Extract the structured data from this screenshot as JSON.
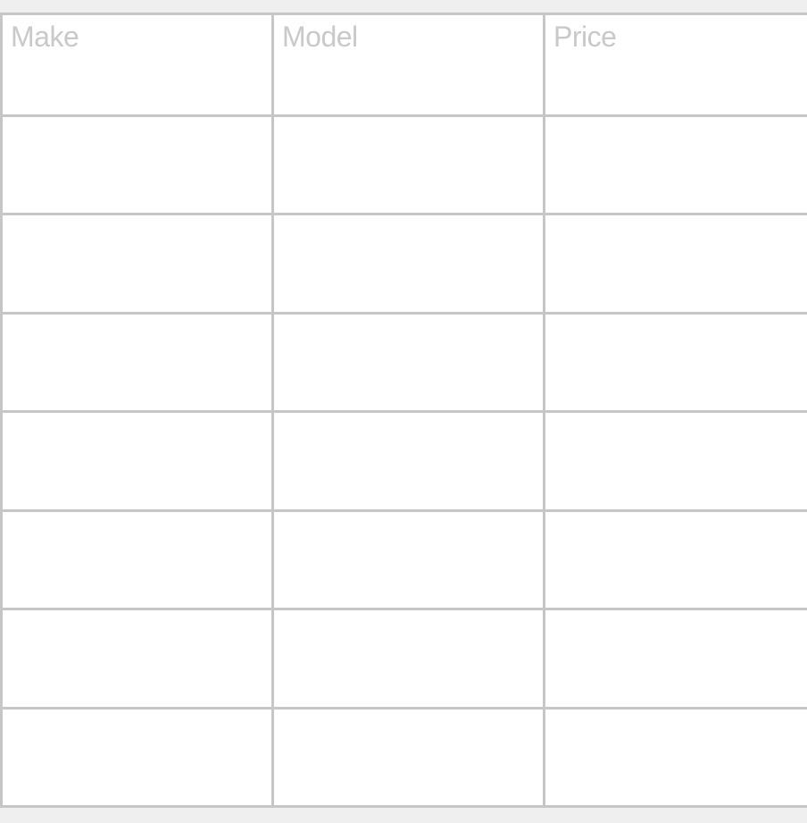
{
  "table": {
    "columns": [
      "Make",
      "Model",
      "Price"
    ],
    "rows": [
      [
        "",
        "",
        ""
      ],
      [
        "",
        "",
        ""
      ],
      [
        "",
        "",
        ""
      ],
      [
        "",
        "",
        ""
      ],
      [
        "",
        "",
        ""
      ],
      [
        "",
        "",
        ""
      ],
      [
        "",
        "",
        ""
      ]
    ]
  }
}
